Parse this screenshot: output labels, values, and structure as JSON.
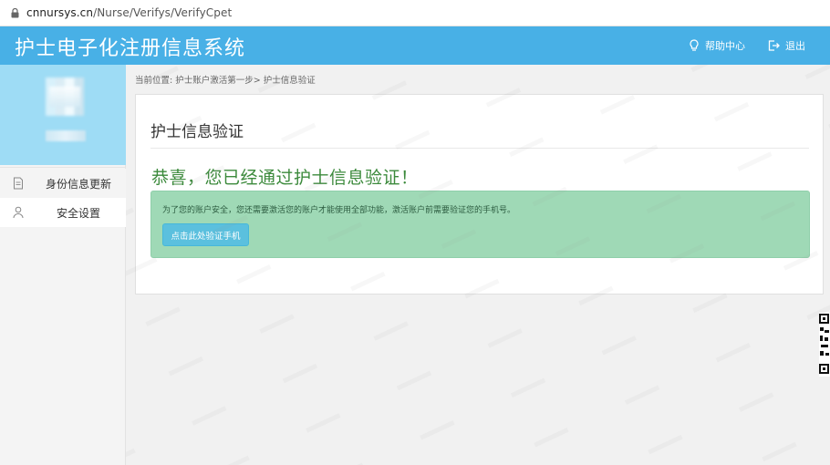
{
  "browser": {
    "url_host": "cnnursys.cn",
    "url_path": "/Nurse/Verifys/VerifyCpet"
  },
  "header": {
    "title": "护士电子化注册信息系统",
    "help_label": "帮助中心",
    "logout_label": "退出"
  },
  "sidebar": {
    "items": [
      {
        "label": "身份信息更新",
        "icon": "document-icon"
      },
      {
        "label": "安全设置",
        "icon": "user-icon"
      }
    ]
  },
  "breadcrumb": {
    "text": "当前位置: 护士账户激活第一步> 护士信息验证"
  },
  "card": {
    "title": "护士信息验证",
    "success_message": "恭喜，您已经通过护士信息验证！",
    "alert_text": "为了您的账户安全，您还需要激活您的账户才能使用全部功能，激活账户前需要验证您的手机号。",
    "verify_button_label": "点击此处验证手机"
  },
  "colors": {
    "header_bg": "#48b0e6",
    "profile_bg": "#9edcf5",
    "success_green": "#3c8a3c",
    "alert_bg": "#9fd9b6",
    "button_bg": "#5bc0de"
  }
}
